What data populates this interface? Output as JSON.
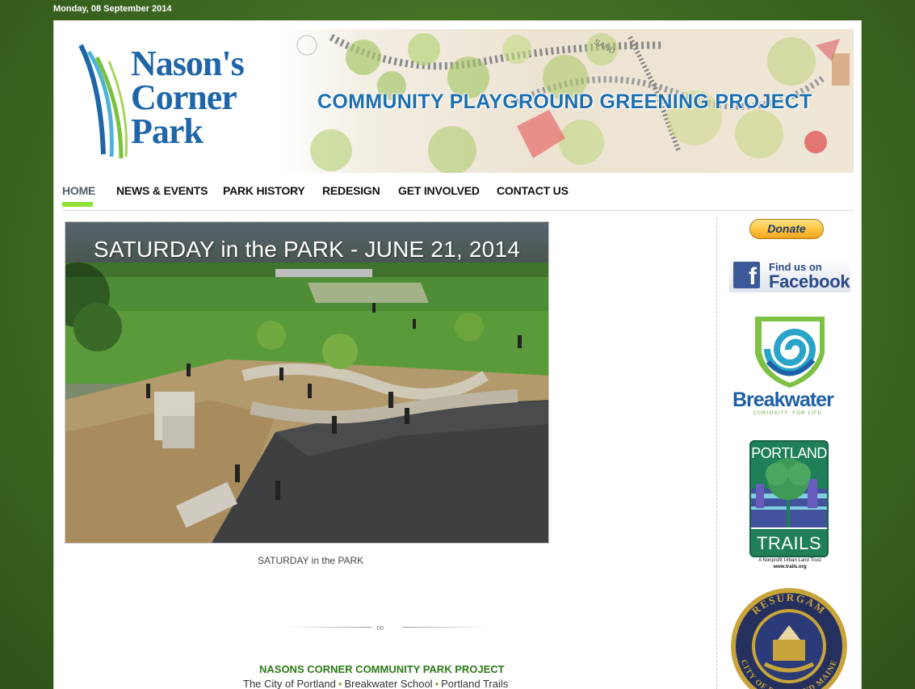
{
  "date": "Monday, 08 September 2014",
  "header": {
    "logo_lines": [
      "Nason's",
      "Corner",
      "Park"
    ],
    "banner_title": "COMMUNITY PLAYGROUND GREENING PROJECT",
    "banner_art_text": "SAND"
  },
  "nav": {
    "items": [
      {
        "label": "HOME",
        "active": true
      },
      {
        "label": "NEWS & EVENTS"
      },
      {
        "label": "PARK HISTORY"
      },
      {
        "label": "REDESIGN"
      },
      {
        "label": "GET INVOLVED"
      },
      {
        "label": "CONTACT US"
      }
    ]
  },
  "feature": {
    "title": "SATURDAY in the PARK - JUNE 21, 2014",
    "caption": "SATURDAY in the PARK"
  },
  "footer": {
    "heading": "NASONS CORNER COMMUNITY PARK PROJECT",
    "links": [
      "The City of Portland",
      "Breakwater School",
      "Portland Trails"
    ],
    "separator": "•"
  },
  "sidebar": {
    "donate_label": "Donate",
    "facebook": {
      "line1": "Find us on",
      "line2": "Facebook",
      "logo": "f"
    },
    "breakwater": {
      "name": "Breakwater",
      "tagline": "CURIOSITY. FOR LIFE."
    },
    "portland_trails": {
      "top": "PORTLAND",
      "bottom": "TRAILS",
      "sub": "A Nonprofit Urban Land Trust",
      "url": "www.trails.org"
    },
    "seal": {
      "top_text": "RESURGAM",
      "bottom_text": "CITY OF PORTLAND MAINE"
    }
  },
  "colors": {
    "background": "#3f6b22",
    "nav_active_underline": "#8fe13a",
    "logo_blue": "#1f66a8",
    "footer_heading": "#2d7a17",
    "donate": "#fdc33c",
    "facebook": "#3b5998",
    "trails_green": "#1f7f58"
  }
}
